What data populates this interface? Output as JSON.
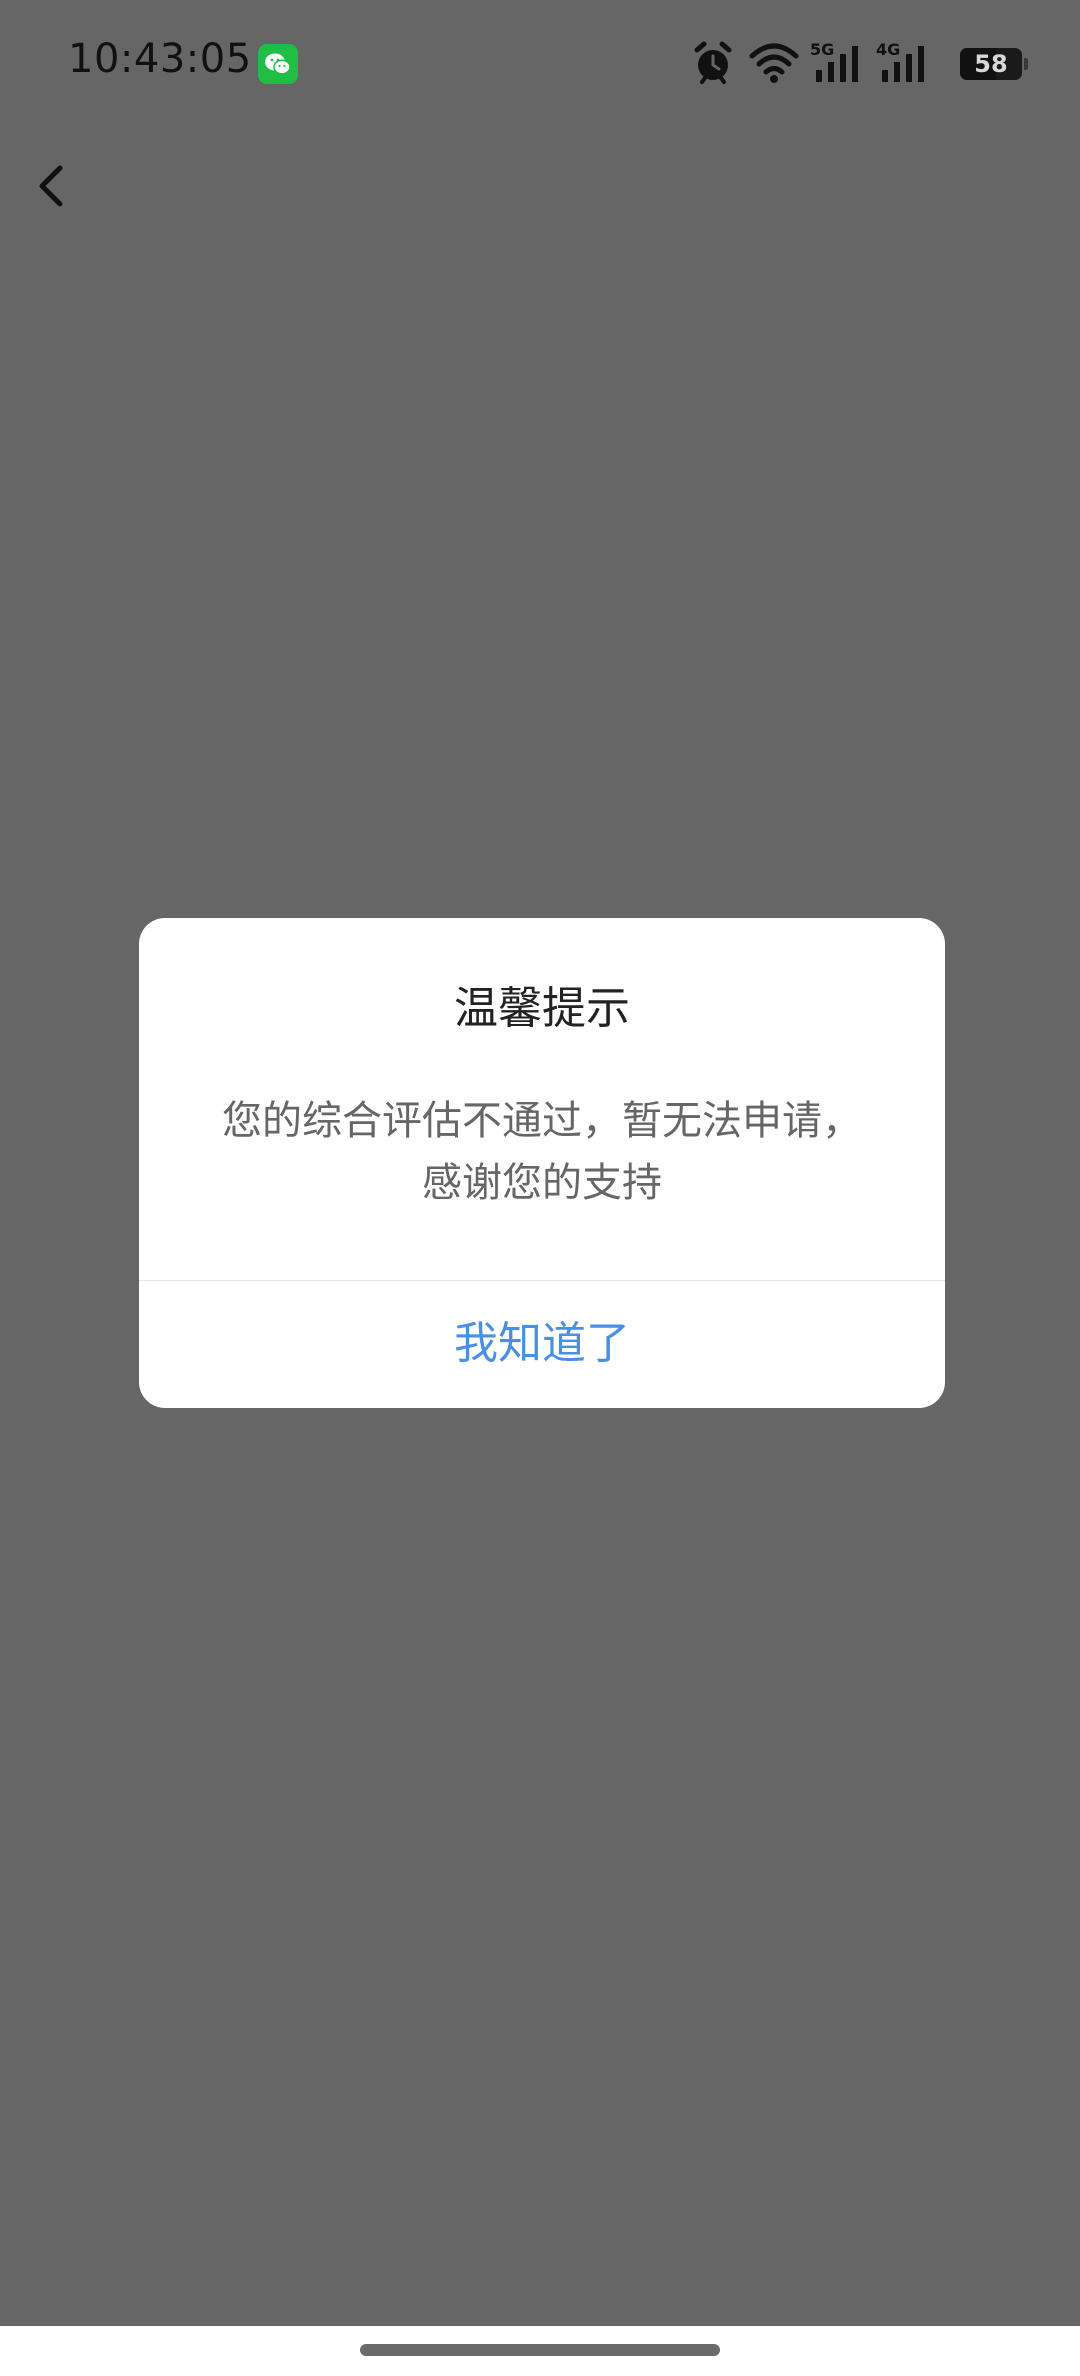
{
  "status_bar": {
    "time": "10:43:05",
    "icons": [
      "wechat-icon",
      "alarm-icon",
      "wifi-icon",
      "5g-signal-icon",
      "4g-signal-icon",
      "battery-icon"
    ],
    "network_5g": "5G",
    "network_4g": "4G",
    "battery_level": "58",
    "battery_fraction": 0.58
  },
  "nav": {
    "back_icon": "chevron-left-icon"
  },
  "dialog": {
    "title": "温馨提示",
    "message": "您的综合评估不通过，暂无法申请，感谢您的支持",
    "confirm_label": "我知道了"
  },
  "colors": {
    "overlay": "#666666",
    "dialog_bg": "#ffffff",
    "accent": "#4a90e2",
    "wechat_green": "#1fbe45"
  }
}
